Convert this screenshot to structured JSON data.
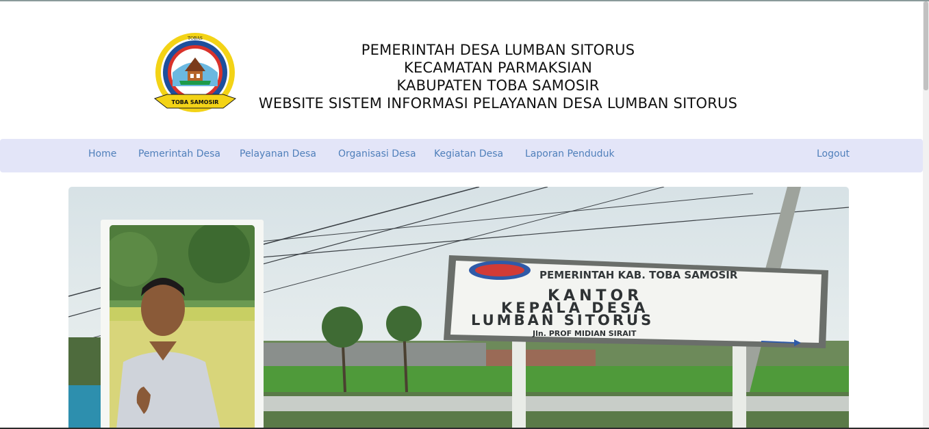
{
  "header": {
    "logo_text_top": "TOBAS",
    "logo_ribbon": "TOBA SAMOSIR",
    "lines": [
      "PEMERINTAH DESA LUMBAN SITORUS",
      "KECAMATAN PARMAKSIAN",
      "KABUPATEN TOBA SAMOSIR",
      "WEBSITE SISTEM INFORMASI PELAYANAN DESA LUMBAN SITORUS"
    ]
  },
  "nav": {
    "items": [
      {
        "label": "Home"
      },
      {
        "label": "Pemerintah Desa"
      },
      {
        "label": "Pelayanan Desa"
      },
      {
        "label": "Organisasi Desa"
      },
      {
        "label": "Kegiatan Desa"
      },
      {
        "label": "Laporan Penduduk"
      }
    ],
    "logout": "Logout"
  },
  "hero": {
    "sign": {
      "line1": "PEMERINTAH KAB. TOBA SAMOSIR",
      "line2": "KANTOR",
      "line3": "KEPALA DESA",
      "line4": "LUMBAN SITORUS",
      "line5": "Jln. PROF MIDIAN SIRAIT"
    }
  },
  "colors": {
    "nav_bg": "#e3e5f8",
    "nav_link": "#4f7fba"
  }
}
